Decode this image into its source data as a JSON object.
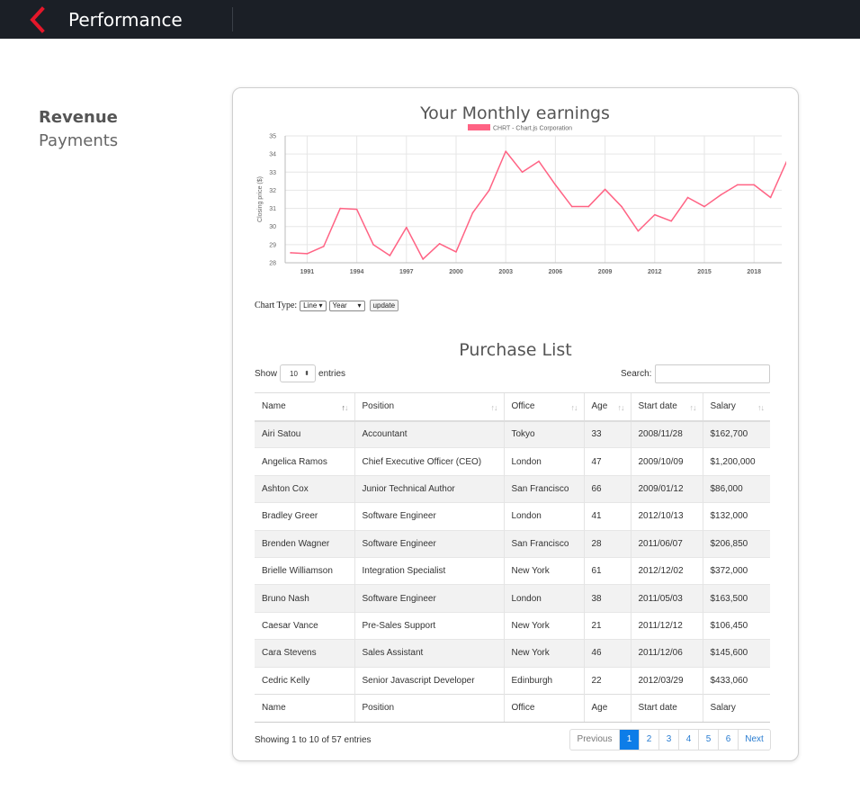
{
  "header": {
    "title": "Performance",
    "back_icon": "chevron-left-icon",
    "accent": "#e5172a"
  },
  "sidebar": {
    "items": [
      {
        "label": "Revenue"
      },
      {
        "label": "Payments"
      }
    ]
  },
  "chart": {
    "controls": {
      "label": "Chart Type:",
      "type_value": "Line",
      "period_value": "Year",
      "update_label": "update"
    }
  },
  "chart_data": {
    "type": "line",
    "title": "Your Monthly earnings",
    "ylabel": "Closing price ($)",
    "xlabel": "",
    "legend": "top-center",
    "ylim": [
      28,
      35
    ],
    "grid": true,
    "x_ticks": [
      "1991",
      "1994",
      "1997",
      "2000",
      "2003",
      "2006",
      "2009",
      "2012",
      "2015",
      "2018"
    ],
    "y_ticks": [
      "28",
      "29",
      "30",
      "31",
      "32",
      "33",
      "34",
      "35"
    ],
    "series": [
      {
        "name": "CHRT - Chart.js Corporation",
        "color": "#ff6384",
        "x": [
          1990,
          1991,
          1992,
          1993,
          1994,
          1995,
          1996,
          1997,
          1998,
          1999,
          2000,
          2001,
          2002,
          2003,
          2004,
          2005,
          2006,
          2007,
          2008,
          2009,
          2010,
          2011,
          2012,
          2013,
          2014,
          2015,
          2016,
          2017,
          2018,
          2019,
          2020
        ],
        "values": [
          28.55,
          28.5,
          28.9,
          31.0,
          30.95,
          29.0,
          28.4,
          29.95,
          28.2,
          29.05,
          28.6,
          30.75,
          32.0,
          34.15,
          33.0,
          33.6,
          32.3,
          31.1,
          31.1,
          32.05,
          31.1,
          29.75,
          30.65,
          30.3,
          31.6,
          31.1,
          31.75,
          32.3,
          32.3,
          31.6,
          33.65
        ]
      }
    ]
  },
  "table": {
    "title": "Purchase List",
    "show_label": "Show",
    "length_value": "10",
    "entries_label": "entries",
    "search_label": "Search:",
    "columns": [
      "Name",
      "Position",
      "Office",
      "Age",
      "Start date",
      "Salary"
    ],
    "rows": [
      [
        "Airi Satou",
        "Accountant",
        "Tokyo",
        "33",
        "2008/11/28",
        "$162,700"
      ],
      [
        "Angelica Ramos",
        "Chief Executive Officer (CEO)",
        "London",
        "47",
        "2009/10/09",
        "$1,200,000"
      ],
      [
        "Ashton Cox",
        "Junior Technical Author",
        "San Francisco",
        "66",
        "2009/01/12",
        "$86,000"
      ],
      [
        "Bradley Greer",
        "Software Engineer",
        "London",
        "41",
        "2012/10/13",
        "$132,000"
      ],
      [
        "Brenden Wagner",
        "Software Engineer",
        "San Francisco",
        "28",
        "2011/06/07",
        "$206,850"
      ],
      [
        "Brielle Williamson",
        "Integration Specialist",
        "New York",
        "61",
        "2012/12/02",
        "$372,000"
      ],
      [
        "Bruno Nash",
        "Software Engineer",
        "London",
        "38",
        "2011/05/03",
        "$163,500"
      ],
      [
        "Caesar Vance",
        "Pre-Sales Support",
        "New York",
        "21",
        "2011/12/12",
        "$106,450"
      ],
      [
        "Cara Stevens",
        "Sales Assistant",
        "New York",
        "46",
        "2011/12/06",
        "$145,600"
      ],
      [
        "Cedric Kelly",
        "Senior Javascript Developer",
        "Edinburgh",
        "22",
        "2012/03/29",
        "$433,060"
      ]
    ],
    "footer": [
      "Name",
      "Position",
      "Office",
      "Age",
      "Start date",
      "Salary"
    ],
    "info": "Showing 1 to 10 of 57 entries",
    "pagination": {
      "previous": "Previous",
      "pages": [
        "1",
        "2",
        "3",
        "4",
        "5",
        "6"
      ],
      "active": "1",
      "next": "Next"
    }
  }
}
